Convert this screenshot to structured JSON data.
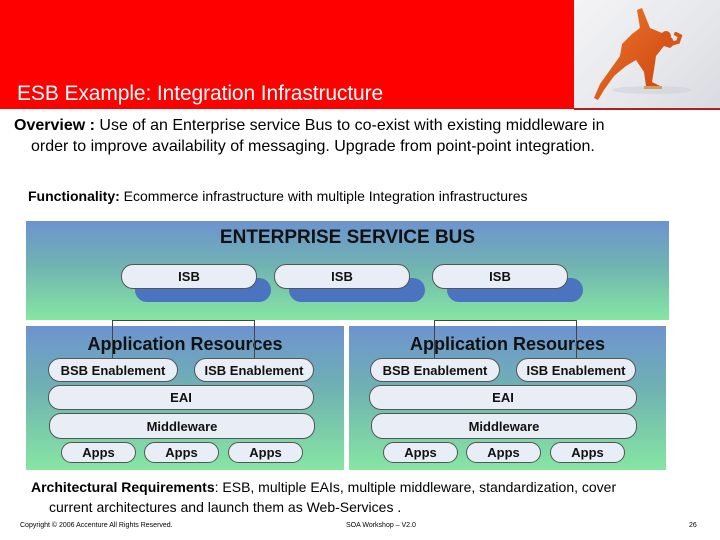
{
  "header": {
    "title": "ESB Example:  Integration Infrastructure",
    "banner_color": "#fe0000",
    "photo": "speed-skater-image"
  },
  "overview": {
    "label": "Overview :",
    "line1": " Use of an Enterprise service Bus to co-exist with existing middleware in",
    "line2": "order to improve availability of messaging. Upgrade from point-point integration."
  },
  "functionality": {
    "label": "Functionality:",
    "text": " Ecommerce infrastructure with multiple Integration infrastructures"
  },
  "diagram": {
    "esb": {
      "title": "ENTERPRISE SERVICE BUS",
      "isb_nodes": [
        "ISB",
        "ISB",
        "ISB"
      ]
    },
    "panels": [
      {
        "title": "Application Resources",
        "enablements": [
          "BSB Enablement",
          "ISB Enablement"
        ],
        "eai": "EAI",
        "middleware": "Middleware",
        "apps": [
          "Apps",
          "Apps",
          "Apps"
        ]
      },
      {
        "title": "Application Resources",
        "enablements": [
          "BSB Enablement",
          "ISB Enablement"
        ],
        "eai": "EAI",
        "middleware": "Middleware",
        "apps": [
          "Apps",
          "Apps",
          "Apps"
        ]
      }
    ],
    "colors": {
      "gradient_top": "#6d93cf",
      "gradient_bottom": "#86e6a2",
      "pill_fill": "#e8edf6",
      "isb_shadow": "#4a74c0"
    }
  },
  "requirements": {
    "label": "Architectural Requirements",
    "line1": ": ESB, multiple EAIs, multiple middleware, standardization, cover",
    "line2": "current architectures and launch them as Web-Services ."
  },
  "footer": {
    "copyright": "Copyright © 2006 Accenture All Rights Reserved.",
    "center": "SOA Workshop – V2.0",
    "page": "26"
  }
}
